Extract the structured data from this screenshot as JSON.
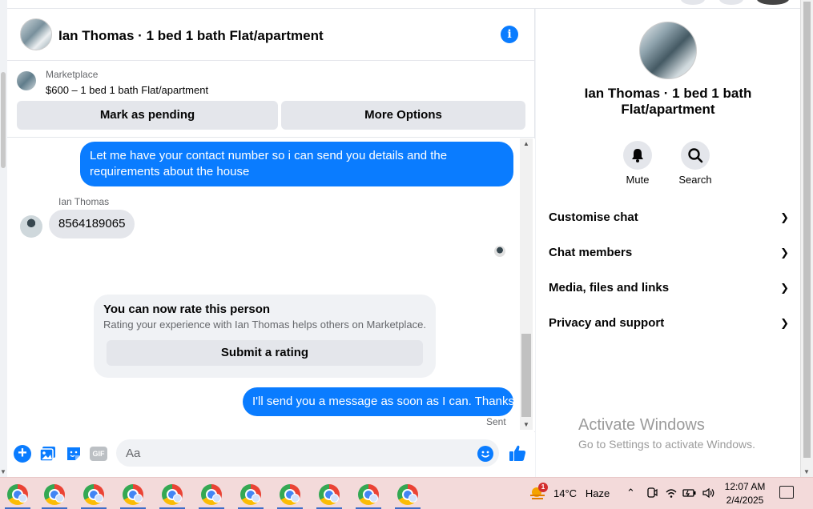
{
  "header": {
    "title": "Ian Thomas · 1 bed 1 bath Flat/apartment"
  },
  "marketplace": {
    "label": "Marketplace",
    "listing": "$600 – 1 bed 1 bath Flat/apartment",
    "pending_button": "Mark as pending",
    "more_button": "More Options"
  },
  "messages": {
    "outgoing_1": "Let me have your contact number so i can send you details and the requirements about the house",
    "sender_name": "Ian Thomas",
    "incoming_1": "8564189065",
    "rating": {
      "heading": "You can now rate this person",
      "sub": "Rating your experience with Ian Thomas helps others on Marketplace.",
      "button": "Submit a rating"
    },
    "outgoing_2": "I'll send you a message as soon as I can. Thanks",
    "status": "Sent"
  },
  "composer": {
    "placeholder": "Aa",
    "gif_label": "GIF"
  },
  "info_panel": {
    "name": "Ian Thomas · 1 bed 1 bath Flat/apartment",
    "mute_label": "Mute",
    "search_label": "Search",
    "sections": [
      "Customise chat",
      "Chat members",
      "Media, files and links",
      "Privacy and support"
    ]
  },
  "watermark": {
    "line1": "Activate Windows",
    "line2": "Go to Settings to activate Windows."
  },
  "taskbar": {
    "weather_badge": "1",
    "temperature": "14°C",
    "condition": "Haze",
    "time": "12:07 AM",
    "date": "2/4/2025"
  },
  "colors": {
    "accent": "#0a7cff",
    "bubble_in": "#e4e6eb",
    "taskbar": "#f3dada"
  }
}
